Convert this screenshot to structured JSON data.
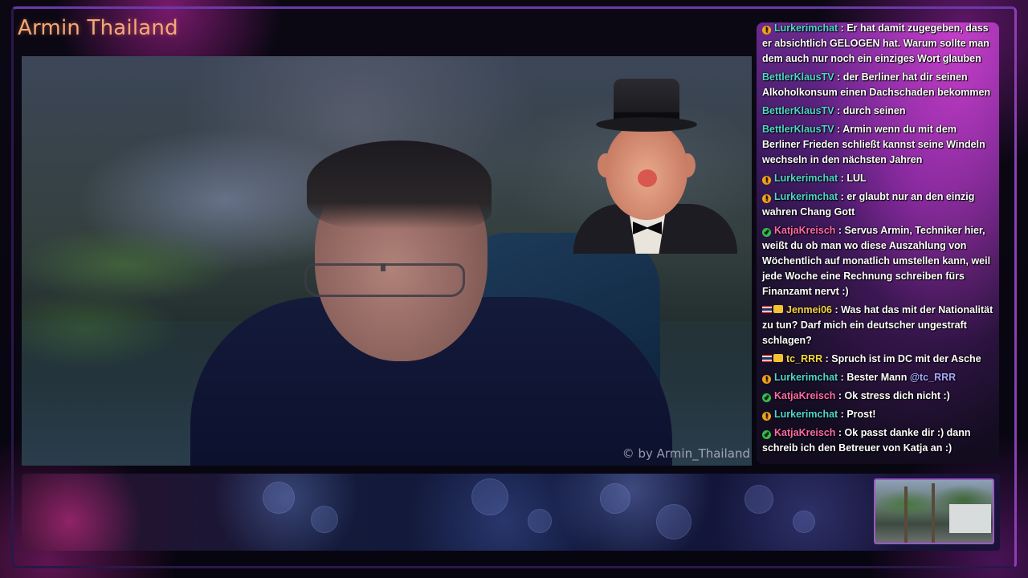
{
  "stream": {
    "title": "Armin Thailand",
    "watermark": "© by Armin_Thailand"
  },
  "colors": {
    "title": "#f5a878",
    "username_teal": "#4fd6c8",
    "username_pink": "#ff6aa6",
    "username_yellow": "#f5d542",
    "accent_purple": "#9a5ac0"
  },
  "chat": {
    "messages": [
      {
        "badge": "orange-icon",
        "user": "Lurkerimchat",
        "sep": " : ",
        "text": "Er hat damit zugegeben, dass er absichtlich GELOGEN hat. Warum sollte man dem auch nur noch ein einziges Wort glauben"
      },
      {
        "badge": "",
        "user": "BettlerKlausTV",
        "sep": " : ",
        "text": "der Berliner hat dir seinen Alkoholkonsum einen Dachschaden bekommen"
      },
      {
        "badge": "",
        "user": "BettlerKlausTV",
        "sep": " : ",
        "text": "durch seinen"
      },
      {
        "badge": "",
        "user": "BettlerKlausTV",
        "sep": " : ",
        "text": "Armin wenn du mit dem Berliner Frieden schließt kannst seine Windeln wechseln in den nächsten Jahren"
      },
      {
        "badge": "orange-icon",
        "user": "Lurkerimchat",
        "sep": " : ",
        "text": "LUL"
      },
      {
        "badge": "orange-icon",
        "user": "Lurkerimchat",
        "sep": " : ",
        "text": "er glaubt nur an den einzig wahren Chang Gott"
      },
      {
        "badge": "green-icon",
        "user": "KatjaKreisch",
        "sep": " : ",
        "text": "Servus Armin, Techniker hier, weißt du ob man wo diese Auszahlung von Wöchentlich auf monatlich umstellen kann, weil jede Woche eine Rechnung schreiben fürs Finanzamt nervt :)"
      },
      {
        "badge": "flag-crown-icon",
        "user": "Jenmei06",
        "sep": " : ",
        "text": "Was hat das mit der Nationalität zu tun? Darf mich ein deutscher ungestraft schlagen?"
      },
      {
        "badge": "flag-crown-icon",
        "user": "tc_RRR",
        "sep": " : ",
        "text": "Spruch ist im DC mit der Asche"
      },
      {
        "badge": "orange-icon",
        "user": "Lurkerimchat",
        "sep": " : ",
        "text": "Bester Mann ",
        "mention": "@tc_RRR"
      },
      {
        "badge": "green-icon",
        "user": "KatjaKreisch",
        "sep": " : ",
        "text": "Ok stress dich nicht :)"
      },
      {
        "badge": "orange-icon",
        "user": "Lurkerimchat",
        "sep": " : ",
        "text": "Prost!"
      },
      {
        "badge": "green-icon",
        "user": "KatjaKreisch",
        "sep": " : ",
        "text": "Ok passt danke dir :) dann schreib ich den Betreuer von Katja an :)"
      }
    ]
  }
}
